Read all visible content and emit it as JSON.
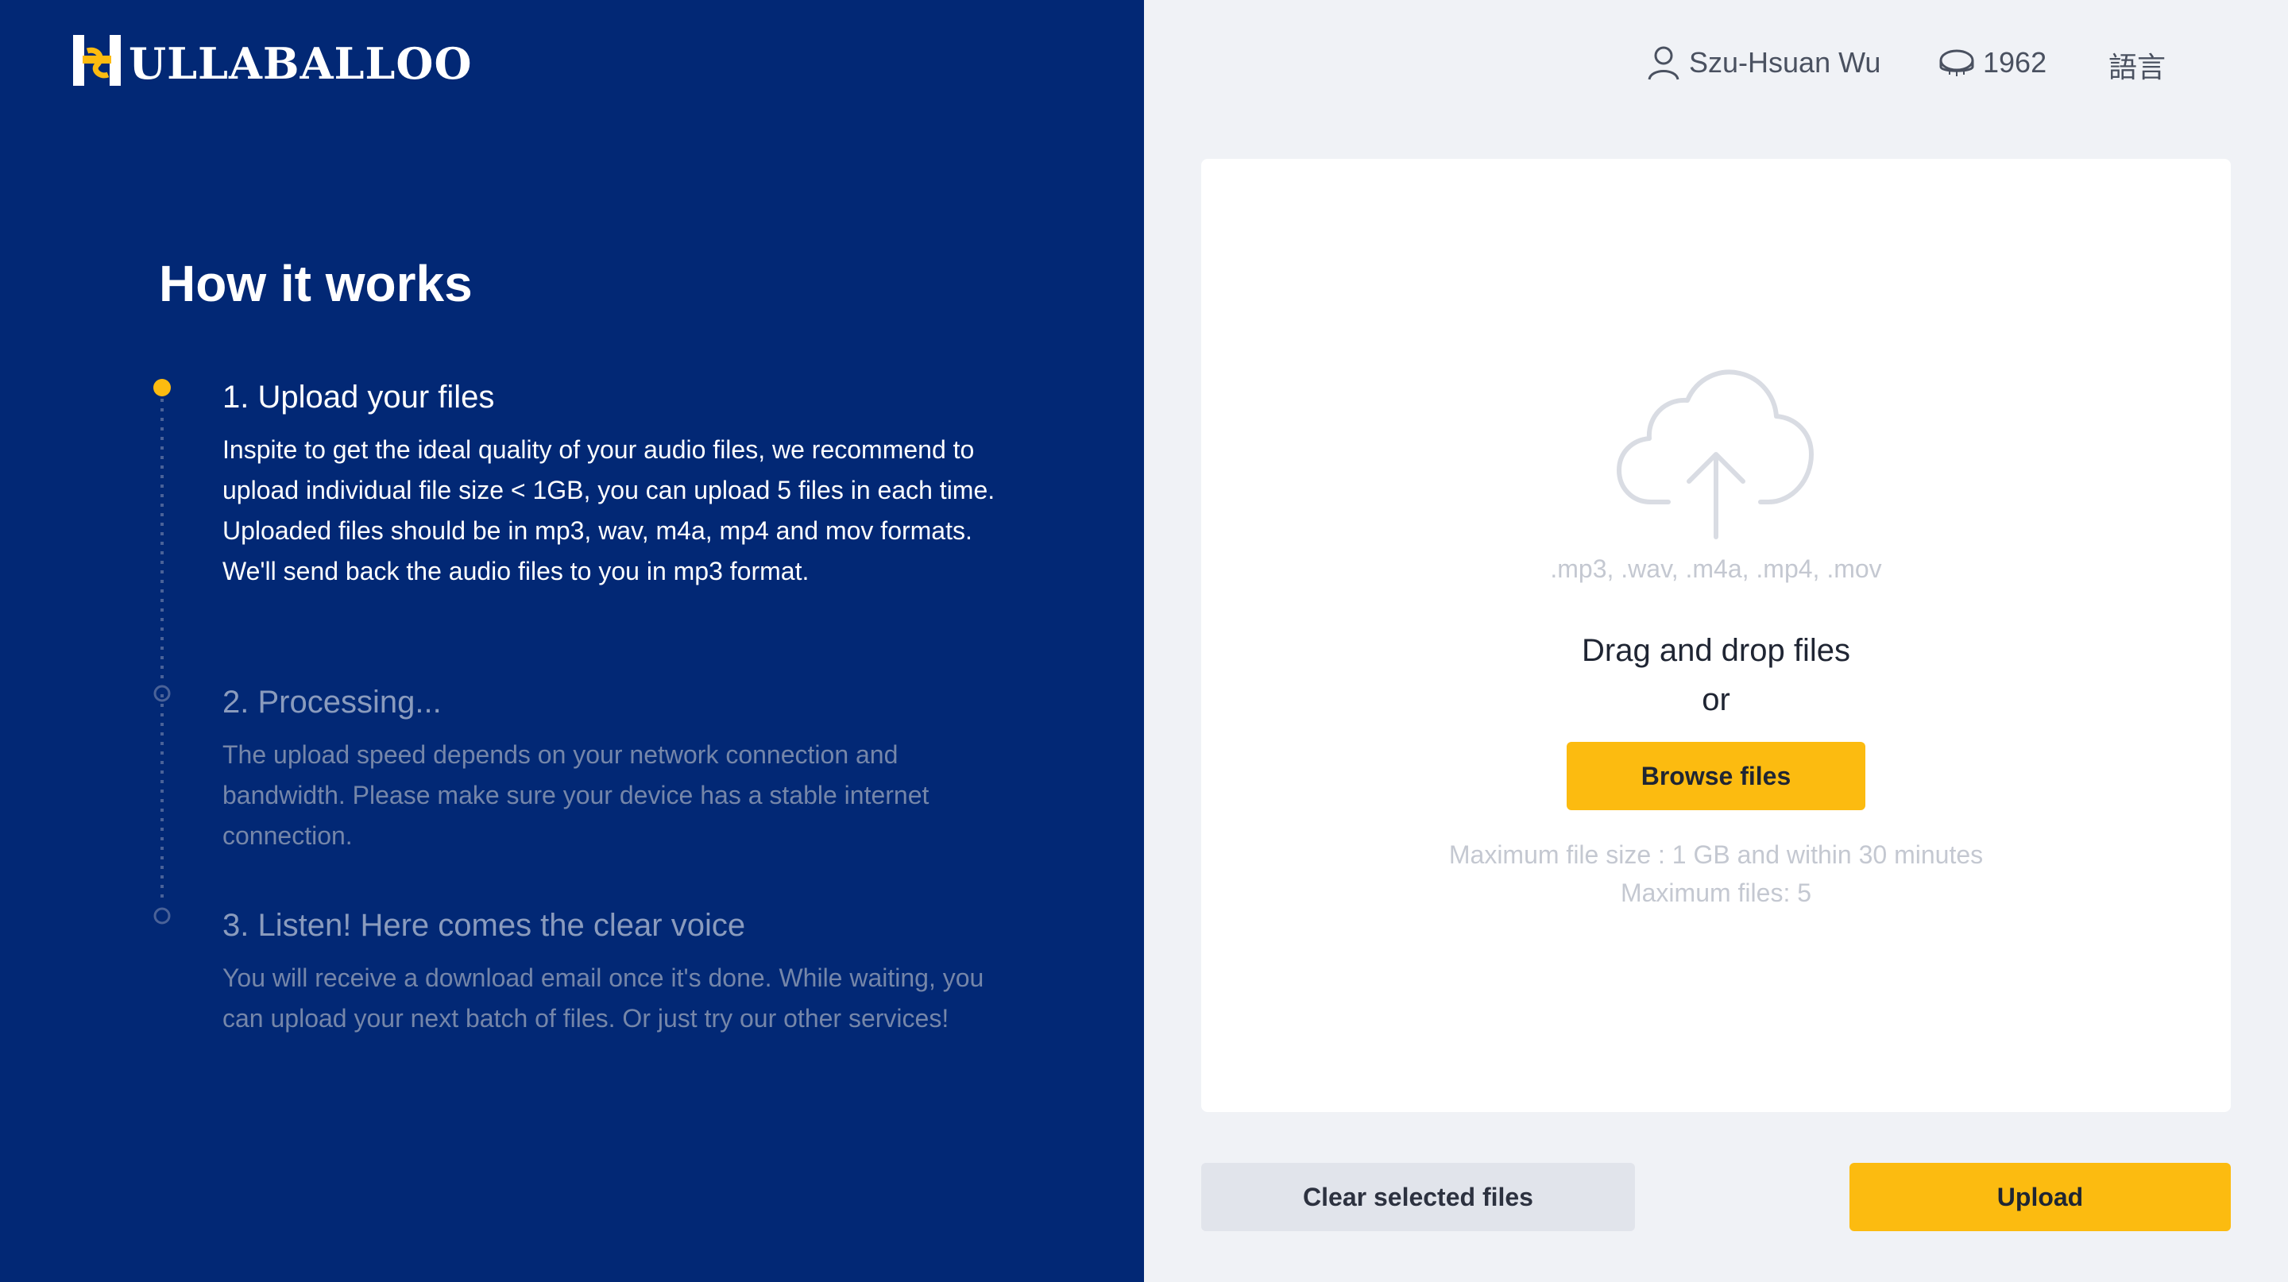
{
  "brand": {
    "name": "ULLABALLOO"
  },
  "left": {
    "title": "How it works",
    "steps": [
      {
        "title": "1. Upload your files",
        "desc": "Inspite to get the ideal quality of your audio files, we recommend to upload individual file size < 1GB, you can upload 5 files in each time. Uploaded files should be in mp3, wav, m4a, mp4 and mov formats. We'll send back the audio files to you in mp3 format."
      },
      {
        "title": "2. Processing...",
        "desc": "The upload speed depends on your network connection and bandwidth. Please make sure your device has a stable internet connection."
      },
      {
        "title": "3. Listen! Here comes the clear voice",
        "desc": "You will receive a download email once it's done. While waiting, you can upload your next batch of files. Or just try our other services!"
      }
    ]
  },
  "header": {
    "user_name": "Szu-Hsuan Wu",
    "credits": "1962",
    "language_label": "語言"
  },
  "dropzone": {
    "formats": ".mp3, .wav, .m4a, .mp4, .mov",
    "drag_line1": "Drag and drop files",
    "drag_line2": "or",
    "browse_label": "Browse files",
    "limit_size": "Maximum file size : 1 GB and within 30 minutes",
    "limit_count": "Maximum files: 5"
  },
  "actions": {
    "clear_label": "Clear selected files",
    "upload_label": "Upload"
  },
  "colors": {
    "panel_bg": "#022875",
    "accent": "#fcbb10",
    "page_bg": "#f0f2f6"
  }
}
